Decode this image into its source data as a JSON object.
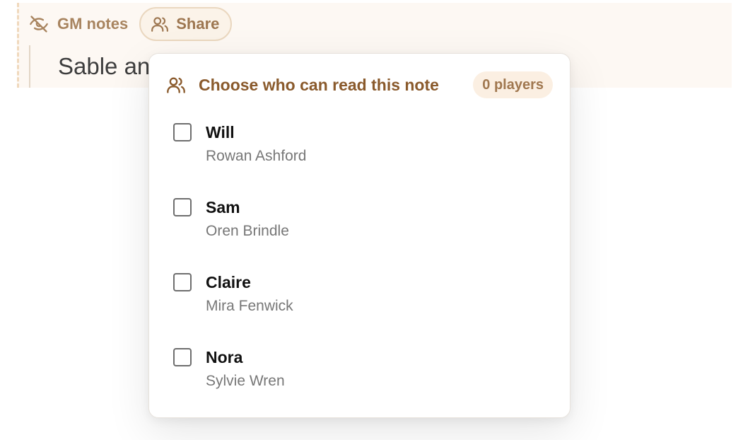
{
  "gm_notes": {
    "label": "GM notes",
    "label_icon": "eye-off-icon",
    "share_label": "Share",
    "share_icon": "users-icon",
    "note_text_visible": "Sable an"
  },
  "share_popover": {
    "title": "Choose who can read this note",
    "title_icon": "users-icon",
    "count_badge": "0 players",
    "players": [
      {
        "name": "Will",
        "character": "Rowan Ashford",
        "checked": false
      },
      {
        "name": "Sam",
        "character": "Oren Brindle",
        "checked": false
      },
      {
        "name": "Claire",
        "character": "Mira Fenwick",
        "checked": false
      },
      {
        "name": "Nora",
        "character": "Sylvie Wren",
        "checked": false
      }
    ]
  },
  "colors": {
    "accent_brown": "#8a5a2c",
    "callout_bg": "#fdf8f3",
    "badge_bg": "#fbefe2"
  }
}
